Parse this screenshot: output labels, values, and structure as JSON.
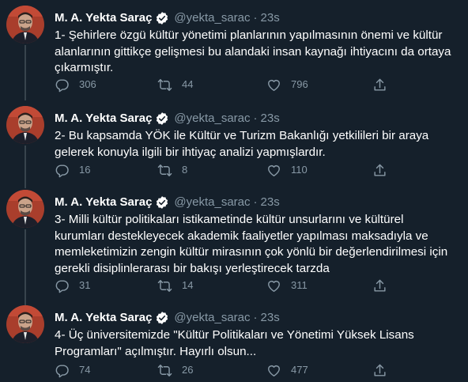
{
  "colors": {
    "background": "#15202b",
    "text": "#ffffff",
    "secondary_text": "#8899a6",
    "verified_badge": "#ffffff",
    "thread_line": "#38444d"
  },
  "icons": {
    "verified": "verified-badge-icon",
    "reply": "reply-icon",
    "retweet": "retweet-icon",
    "like": "heart-icon",
    "share": "share-icon"
  },
  "tweets": [
    {
      "author_name": "M. A. Yekta Saraç",
      "handle": "@yekta_sarac",
      "separator": "·",
      "time": "23s",
      "text": "1- Şehirlere özgü kültür yönetimi planlarının yapılmasının önemi  ve kültür\nalanlarının gittikçe gelişmesi bu alandaki insan kaynağı ihtiyacını da ortaya\nçıkarmıştır.",
      "replies": "306",
      "retweets": "44",
      "likes": "796"
    },
    {
      "author_name": "M. A. Yekta Saraç",
      "handle": "@yekta_sarac",
      "separator": "·",
      "time": "23s",
      "text": "2- Bu kapsamda YÖK ile Kültür ve Turizm Bakanlığı yetkilileri bir araya\ngelerek konuyla ilgili bir ihtiyaç analizi yapmışlardır.",
      "replies": "16",
      "retweets": "8",
      "likes": "110"
    },
    {
      "author_name": "M. A. Yekta Saraç",
      "handle": "@yekta_sarac",
      "separator": "·",
      "time": "23s",
      "text": "3- Milli kültür politikaları istikametinde kültür unsurlarını ve kültürel\nkurumları destekleyecek akademik faaliyetler yapılması maksadıyla ve\nmemleketimizin zengin kültür mirasının çok yönlü bir değerlendirilmesi için\ngerekli disiplinlerarası bir bakışı yerleştirecek tarzda",
      "replies": "31",
      "retweets": "14",
      "likes": "311"
    },
    {
      "author_name": "M. A. Yekta Saraç",
      "handle": "@yekta_sarac",
      "separator": "·",
      "time": "23s",
      "text": "4- Üç üniversitemizde \"Kültür Politikaları ve Yönetimi Yüksek Lisans\nProgramları\" açılmıştır. Hayırlı olsun...",
      "replies": "74",
      "retweets": "26",
      "likes": "477"
    }
  ]
}
